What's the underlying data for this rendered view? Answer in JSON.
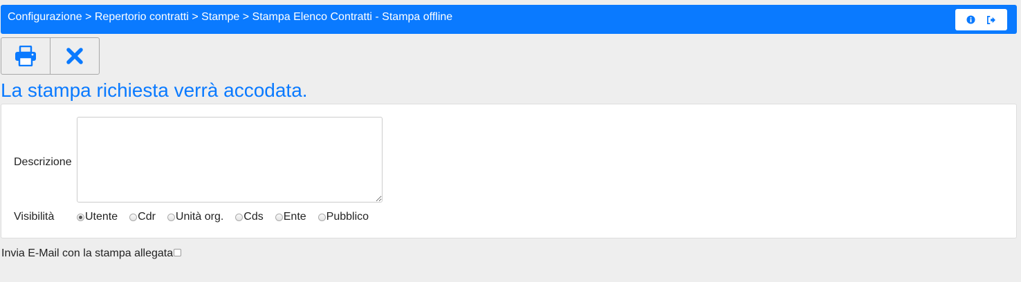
{
  "header": {
    "breadcrumb": "Configurazione > Repertorio contratti > Stampe > Stampa Elenco Contratti - Stampa offline",
    "info_icon": "info-circle-icon",
    "logout_icon": "sign-out-icon",
    "bg_color": "#0a7aff"
  },
  "toolbar": {
    "print_icon": "print-icon",
    "close_icon": "close-icon",
    "close_color": "#0a7aff"
  },
  "notice": "La stampa richiesta verrà accodata.",
  "form": {
    "description_label": "Descrizione",
    "description_value": "",
    "visibility_label": "Visibilità",
    "visibility_options": [
      "Utente",
      "Cdr",
      "Unità org.",
      "Cds",
      "Ente",
      "Pubblico"
    ],
    "visibility_selected": "Utente"
  },
  "email": {
    "label": "Invia E-Mail con la stampa allegata",
    "checked": false
  }
}
